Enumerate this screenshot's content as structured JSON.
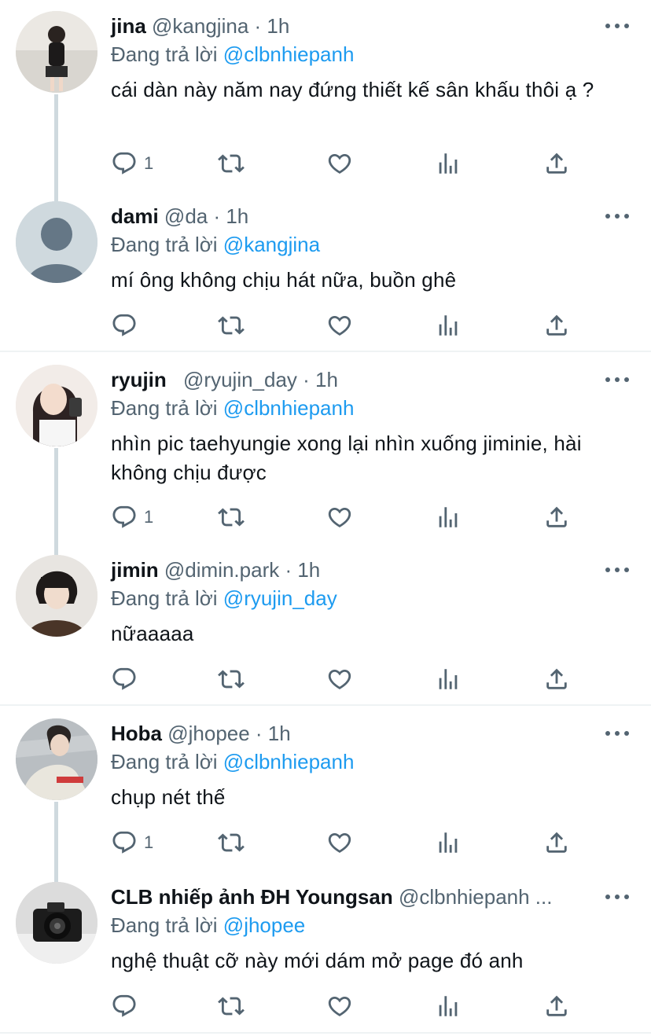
{
  "replying_prefix": "Đang trả lời",
  "time": "1h",
  "colors": {
    "mention": "#1d9bf0",
    "secondary": "#536471",
    "thread_line": "#cfd9de"
  },
  "icons": [
    "reply-icon",
    "retweet-icon",
    "like-icon",
    "views-icon",
    "share-icon",
    "more-icon"
  ],
  "tweets": [
    {
      "name": "jina",
      "handle": "@kangjina · 1h",
      "replying_to": "@clbnhiepanh",
      "text": "cái dàn này năm nay đứng thiết kế sân khấu thôi ạ ?",
      "reply_count": "1"
    },
    {
      "name": "dami",
      "handle": "@da · 1h",
      "replying_to": "@kangjina",
      "text": "mí ông không chịu hát nữa, buồn ghê",
      "reply_count": ""
    },
    {
      "name": "ryujin",
      "handle": "@ryujin_day · 1h",
      "replying_to": "@clbnhiepanh",
      "text": "nhìn pic taehyungie xong lại nhìn xuống jiminie, hài không chịu được",
      "reply_count": "1"
    },
    {
      "name": "jimin",
      "handle": "@dimin.park · 1h",
      "replying_to": "@ryujin_day",
      "text": "nữaaaaa",
      "reply_count": ""
    },
    {
      "name": "Hoba",
      "handle": "@jhopee · 1h",
      "replying_to": "@clbnhiepanh",
      "text": "chụp nét thế",
      "reply_count": "1"
    },
    {
      "name": "CLB nhiếp ảnh ĐH Youngsan",
      "handle": "@clbnhiepanh ...",
      "replying_to": "@jhopee",
      "text": "nghệ thuật cỡ này mới dám mở page đó anh",
      "reply_count": ""
    }
  ]
}
